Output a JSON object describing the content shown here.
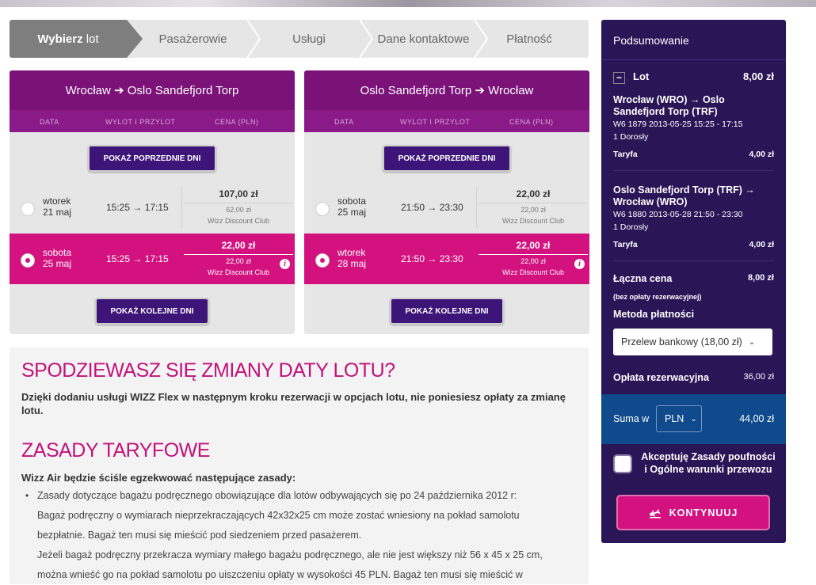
{
  "steps": [
    {
      "label_bold": "Wybierz",
      "label": "lot"
    },
    {
      "label": "Pasażerowie"
    },
    {
      "label": "Usługi"
    },
    {
      "label": "Dane kontaktowe"
    },
    {
      "label": "Płatność"
    }
  ],
  "outbound": {
    "title": "Wrocław ➔ Oslo Sandefjord Torp",
    "cols": {
      "date": "DATA",
      "times": "WYLOT I PRZYLOT",
      "price": "CENA (PLN)"
    },
    "prev_btn": "POKAŻ POPRZEDNIE DNI",
    "next_btn": "POKAŻ KOLEJNE DNI",
    "rows": [
      {
        "day": "wtorek",
        "date": "21 maj",
        "times": "15:25 → 17:15",
        "price": "107,00 zł",
        "club_price": "62,00 zł",
        "club": "Wizz Discount Club"
      },
      {
        "day": "sobota",
        "date": "25 maj",
        "times": "15:25 → 17:15",
        "price": "22,00 zł",
        "club_price": "22,00 zł",
        "club": "Wizz Discount Club"
      }
    ]
  },
  "inbound": {
    "title": "Oslo Sandefjord Torp ➔ Wrocław",
    "cols": {
      "date": "DATA",
      "times": "WYLOT I PRZYLOT",
      "price": "CENA (PLN)"
    },
    "prev_btn": "POKAŻ POPRZEDNIE DNI",
    "next_btn": "POKAŻ KOLEJNE DNI",
    "rows": [
      {
        "day": "sobota",
        "date": "25 maj",
        "times": "21:50 → 23:30",
        "price": "22,00 zł",
        "club_price": "22,00 zł",
        "club": "Wizz Discount Club"
      },
      {
        "day": "wtorek",
        "date": "28 maj",
        "times": "21:50 → 23:30",
        "price": "22,00 zł",
        "club_price": "22,00 zł",
        "club": "Wizz Discount Club"
      }
    ]
  },
  "info": {
    "flex_heading": "SPODZIEWASZ SIĘ ZMIANY DATY LOTU?",
    "flex_text": "Dzięki dodaniu usługi WIZZ Flex w następnym kroku rezerwacji w opcjach lotu, nie poniesiesz opłaty za zmianę lotu.",
    "rules_heading": "ZASADY TARYFOWE",
    "rules_intro": "Wizz Air będzie ściśle egzekwować następujące zasady:",
    "bullet": "•",
    "rules_lines": [
      "Zasady dotyczące bagażu podręcznego obowiązujące dla lotów odbywających się po 24 października 2012 r:",
      "Bagaż podręczny o wymiarach nieprzekraczających 42x32x25 cm może zostać wniesiony na pokład samolotu",
      "bezpłatnie. Bagaż ten musi się mieścić pod siedzeniem przed pasażerem.",
      "Jeżeli bagaż podręczny przekracza wymiary małego bagażu podręcznego, ale nie jest większy niż 56 x 45 x 25 cm,",
      "można wnieść go na pokład samolotu po uiszczeniu opłaty w wysokości 45 PLN. Bagaż ten musi się mieścić w"
    ]
  },
  "summary": {
    "title": "Podsumowanie",
    "lot_label": "Lot",
    "lot_value": "8,00 zł",
    "minus": "−",
    "flights": [
      {
        "title": "Wrocław (WRO) → Oslo Sandefjord Torp (TRF)",
        "meta": "W6 1879  2013-05-25 15:25 - 17:15",
        "pax": "1 Dorosły",
        "fare_label": "Taryfa",
        "fare_value": "4,00 zł"
      },
      {
        "title": "Oslo Sandefjord Torp (TRF) → Wrocław (WRO)",
        "meta": "W6 1880  2013-05-28 21:50 - 23:30",
        "pax": "1 Dorosły",
        "fare_label": "Taryfa",
        "fare_value": "4,00 zł"
      }
    ],
    "total_label": "Łączna cena",
    "total_value": "8,00 zł",
    "total_note": "(bez opłaty rezerwacyjnej)",
    "method_label": "Metoda płatności",
    "method_value": "Przelew bankowy (18,00 zł)",
    "fee_label": "Opłata rezerwacyjna",
    "fee_value": "36,00 zł",
    "sum_label": "Suma w",
    "currency": "PLN",
    "sum_value": "44,00 zł",
    "accept_text": "Akceptuję Zasady poufności i Ogólne warunki przewozu",
    "continue_btn": "KONTYNUUJ",
    "caret": "⌄"
  }
}
